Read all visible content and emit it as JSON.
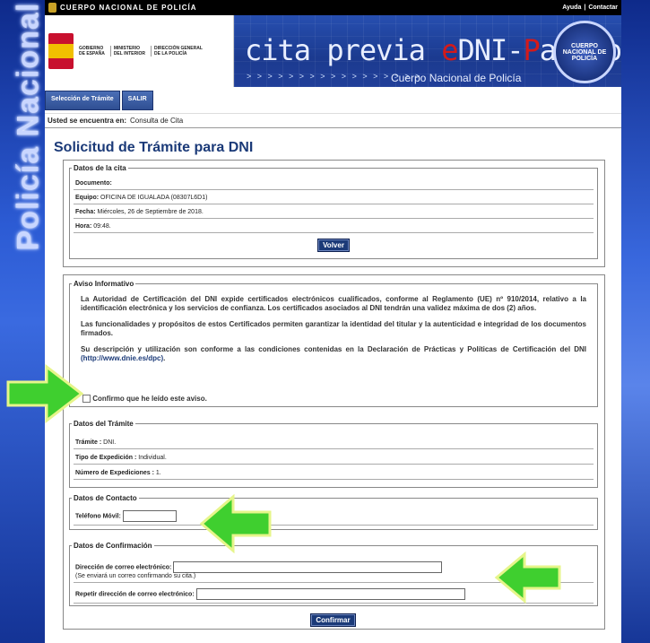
{
  "side_text": "Policía Nacional",
  "topbar": {
    "brand": "CUERPO NACIONAL DE POLICÍA",
    "ayuda": "Ayuda",
    "sep": "|",
    "contactar": "Contactar"
  },
  "gov": {
    "col1": "GOBIERNO\nDE ESPAÑA",
    "col2": "MINISTERIO\nDEL INTERIOR",
    "col3": "DIRECCIÓN GENERAL\nDE LA POLICÍA"
  },
  "banner": {
    "t1": "cita previa ",
    "t2": "e",
    "t3": "DNI-",
    "t4": "P",
    "t5": "asaporte",
    "arrows": "> > > > > > > > > > > > > > > > >",
    "sub": "Cuerpo Nacional de Policía",
    "seal": "CUERPO NACIONAL DE POLICÍA"
  },
  "nav": {
    "btn1": "Selección de Trámite",
    "btn2": "SALIR"
  },
  "breadcrumb": {
    "label": "Usted se encuentra en:",
    "value": "Consulta de Cita"
  },
  "page_title": "Solicitud de Trámite para DNI",
  "cita": {
    "legend": "Datos de la cita",
    "documento_label": "Documento:",
    "documento_value": "",
    "equipo_label": "Equipo:",
    "equipo_value": "OFICINA DE IGUALADA (08307L6D1)",
    "fecha_label": "Fecha:",
    "fecha_value": "Miércoles, 26 de Septiembre de 2018.",
    "hora_label": "Hora:",
    "hora_value": "09:48.",
    "volver": "Volver"
  },
  "aviso": {
    "legend": "Aviso Informativo",
    "p1": "La Autoridad de Certificación del DNI expide certificados electrónicos cualificados, conforme al Reglamento (UE) nº 910/2014, relativo a la identificación electrónica y los servicios de confianza. Los certificados asociados al DNI tendrán una validez máxima de dos (2) años.",
    "p2": "Las funcionalidades y propósitos de estos Certificados permiten garantizar la identidad del titular y la autenticidad e integridad de los documentos firmados.",
    "p3a": "Su descripción y utilización son conforme a las condiciones contenidas en la Declaración de Prácticas y Políticas de Certificación del DNI ",
    "p3link": "(http://www.dnie.es/dpc)",
    "p3b": ".",
    "confirm": "Confirmo que he leído este aviso.",
    "confirm_checked": false
  },
  "tramite": {
    "legend": "Datos del Trámite",
    "tramite_label": "Trámite :",
    "tramite_value": "DNI.",
    "tipo_label": "Tipo de Expedición :",
    "tipo_value": "Individual.",
    "num_label": "Número de Expediciones :",
    "num_value": "1."
  },
  "contacto": {
    "legend": "Datos de Contacto",
    "movil_label": "Teléfono Móvil:",
    "movil_value": ""
  },
  "confirmacion": {
    "legend": "Datos de Confirmación",
    "email_label": "Dirección de correo electrónico:",
    "email_value": "",
    "email_note": "(Se enviará un correo confirmando su cita.)",
    "repeat_label": "Repetir dirección de correo electrónico:",
    "repeat_value": ""
  },
  "confirmar": "Confirmar",
  "colors": {
    "arrow": "#3fcf2f",
    "arrow_edge": "#e6f58a",
    "title": "#1b3a78",
    "button": "#1b3a78"
  }
}
